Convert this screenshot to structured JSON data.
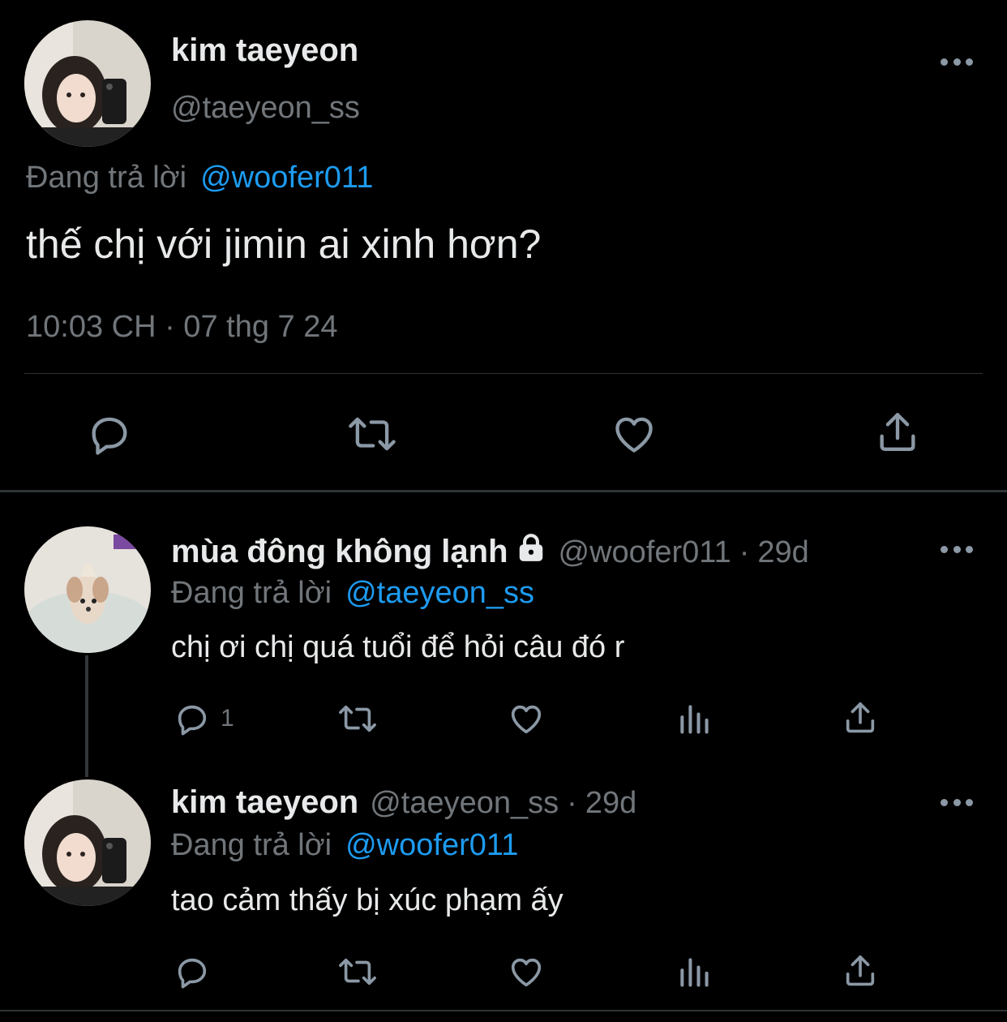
{
  "main_tweet": {
    "name": "kim taeyeon",
    "handle": "@taeyeon_ss",
    "replying_prefix": "Đang trả lời",
    "replying_to": "@woofer011",
    "text": "thế chị với jimin ai xinh hơn?",
    "timestamp": "10:03 CH · 07 thg 7 24"
  },
  "replies": [
    {
      "name": "mùa đông không lạnh",
      "handle": "@woofer011",
      "sep": "·",
      "age": "29d",
      "replying_prefix": "Đang trả lời",
      "replying_to": "@taeyeon_ss",
      "text": "chị ơi chị quá tuổi để hỏi câu đó r",
      "reply_count": "1"
    },
    {
      "name": "kim taeyeon",
      "handle": "@taeyeon_ss",
      "sep": "·",
      "age": "29d",
      "replying_prefix": "Đang trả lời",
      "replying_to": "@woofer011",
      "text": "tao cảm thấy bị xúc phạm ấy",
      "reply_count": ""
    }
  ],
  "icons": {
    "more": "more-icon",
    "reply": "reply-icon",
    "retweet": "retweet-icon",
    "like": "like-icon",
    "views": "views-icon",
    "share": "share-icon",
    "lock": "lock-icon"
  },
  "colors": {
    "background": "#000000",
    "text": "#e7e9ea",
    "muted": "#71767b",
    "link": "#1d9bf0"
  }
}
